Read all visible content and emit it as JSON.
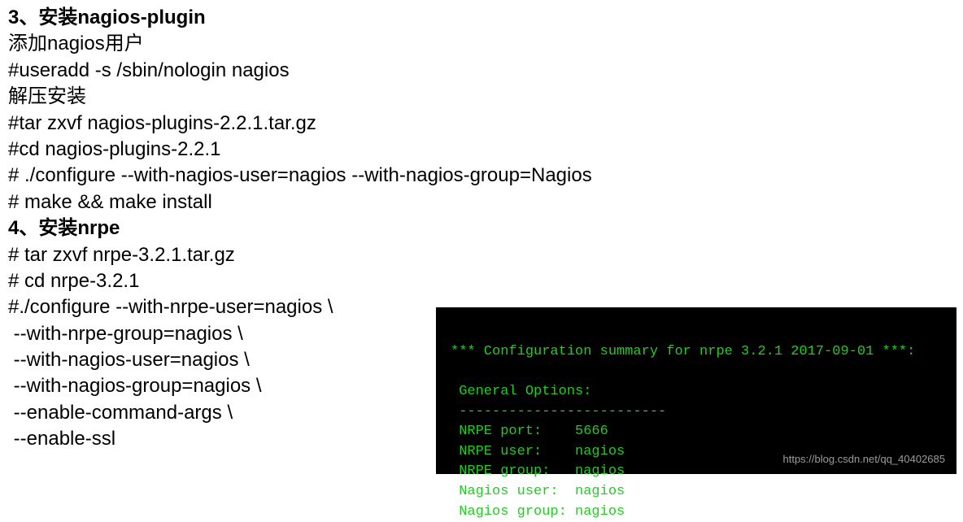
{
  "doc": {
    "section3_heading": "3、安装nagios-plugin",
    "add_user_label": "添加nagios用户",
    "useradd_cmd": "#useradd -s /sbin/nologin nagios",
    "extract_label": "解压安装",
    "tar_plugin_cmd": "#tar zxvf nagios-plugins-2.2.1.tar.gz",
    "cd_plugin_cmd": "#cd nagios-plugins-2.2.1",
    "configure_plugin_cmd": "# ./configure --with-nagios-user=nagios --with-nagios-group=Nagios",
    "make_cmd": "# make && make install",
    "section4_heading": "4、安装nrpe",
    "tar_nrpe_cmd": "# tar zxvf nrpe-3.2.1.tar.gz",
    "cd_nrpe_cmd": "# cd nrpe-3.2.1",
    "cfg_line1": "#./configure --with-nrpe-user=nagios \\",
    "cfg_line2": " --with-nrpe-group=nagios \\",
    "cfg_line3": " --with-nagios-user=nagios \\",
    "cfg_line4": " --with-nagios-group=nagios \\",
    "cfg_line5": " --enable-command-args \\",
    "cfg_line6": " --enable-ssl"
  },
  "terminal": {
    "summary_line": "*** Configuration summary for nrpe 3.2.1 2017-09-01 ***:",
    "general_options": " General Options:",
    "dashes": " -------------------------",
    "nrpe_port": " NRPE port:    5666",
    "nrpe_user": " NRPE user:    nagios",
    "nrpe_group": " NRPE group:   nagios",
    "nagios_user": " Nagios user:  nagios",
    "nagios_group": " Nagios group: nagios"
  },
  "watermark": "https://blog.csdn.net/qq_40402685"
}
